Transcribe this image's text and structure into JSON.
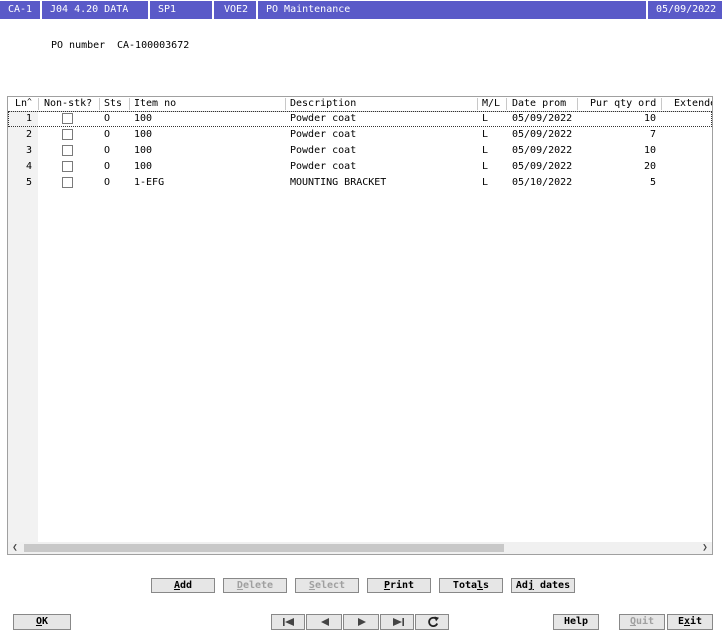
{
  "titlebar": {
    "segments": [
      "CA-1",
      "J04 4.20 DATA",
      "SP1",
      "VOE2",
      "PO Maintenance",
      "05/09/2022"
    ]
  },
  "po": {
    "label": "PO number",
    "value": "CA-100003672"
  },
  "grid": {
    "columns": [
      "Ln",
      "Non-stk?",
      "Sts",
      "Item no",
      "Description",
      "M/L",
      "Date prom",
      "Pur qty ord",
      "Extende"
    ],
    "rows": [
      {
        "ln": "1",
        "sts": "O",
        "item": "100",
        "desc": "Powder coat",
        "ml": "L",
        "date": "05/09/2022",
        "qty": "10"
      },
      {
        "ln": "2",
        "sts": "O",
        "item": "100",
        "desc": "Powder coat",
        "ml": "L",
        "date": "05/09/2022",
        "qty": "7"
      },
      {
        "ln": "3",
        "sts": "O",
        "item": "100",
        "desc": "Powder coat",
        "ml": "L",
        "date": "05/09/2022",
        "qty": "10"
      },
      {
        "ln": "4",
        "sts": "O",
        "item": "100",
        "desc": "Powder coat",
        "ml": "L",
        "date": "05/09/2022",
        "qty": "20"
      },
      {
        "ln": "5",
        "sts": "O",
        "item": "1-EFG",
        "desc": "MOUNTING BRACKET",
        "ml": "L",
        "date": "05/10/2022",
        "qty": "5"
      }
    ]
  },
  "actions": {
    "add": {
      "pre": "",
      "u": "A",
      "post": "dd"
    },
    "delete": {
      "pre": "",
      "u": "D",
      "post": "elete"
    },
    "select": {
      "pre": "",
      "u": "S",
      "post": "elect"
    },
    "print": {
      "pre": "",
      "u": "P",
      "post": "rint"
    },
    "totals": {
      "pre": "Tota",
      "u": "l",
      "post": "s"
    },
    "adjdates": {
      "pre": "Ad",
      "u": "j",
      "post": " dates"
    }
  },
  "footer": {
    "ok": {
      "pre": "",
      "u": "O",
      "post": "K"
    },
    "help": {
      "pre": "Help",
      "u": "",
      "post": ""
    },
    "quit": {
      "pre": "",
      "u": "Q",
      "post": "uit"
    },
    "exit": {
      "pre": "E",
      "u": "x",
      "post": "it"
    }
  },
  "icons": [
    "first-page-icon",
    "prev-icon",
    "next-icon",
    "last-page-icon",
    "refresh-icon"
  ]
}
